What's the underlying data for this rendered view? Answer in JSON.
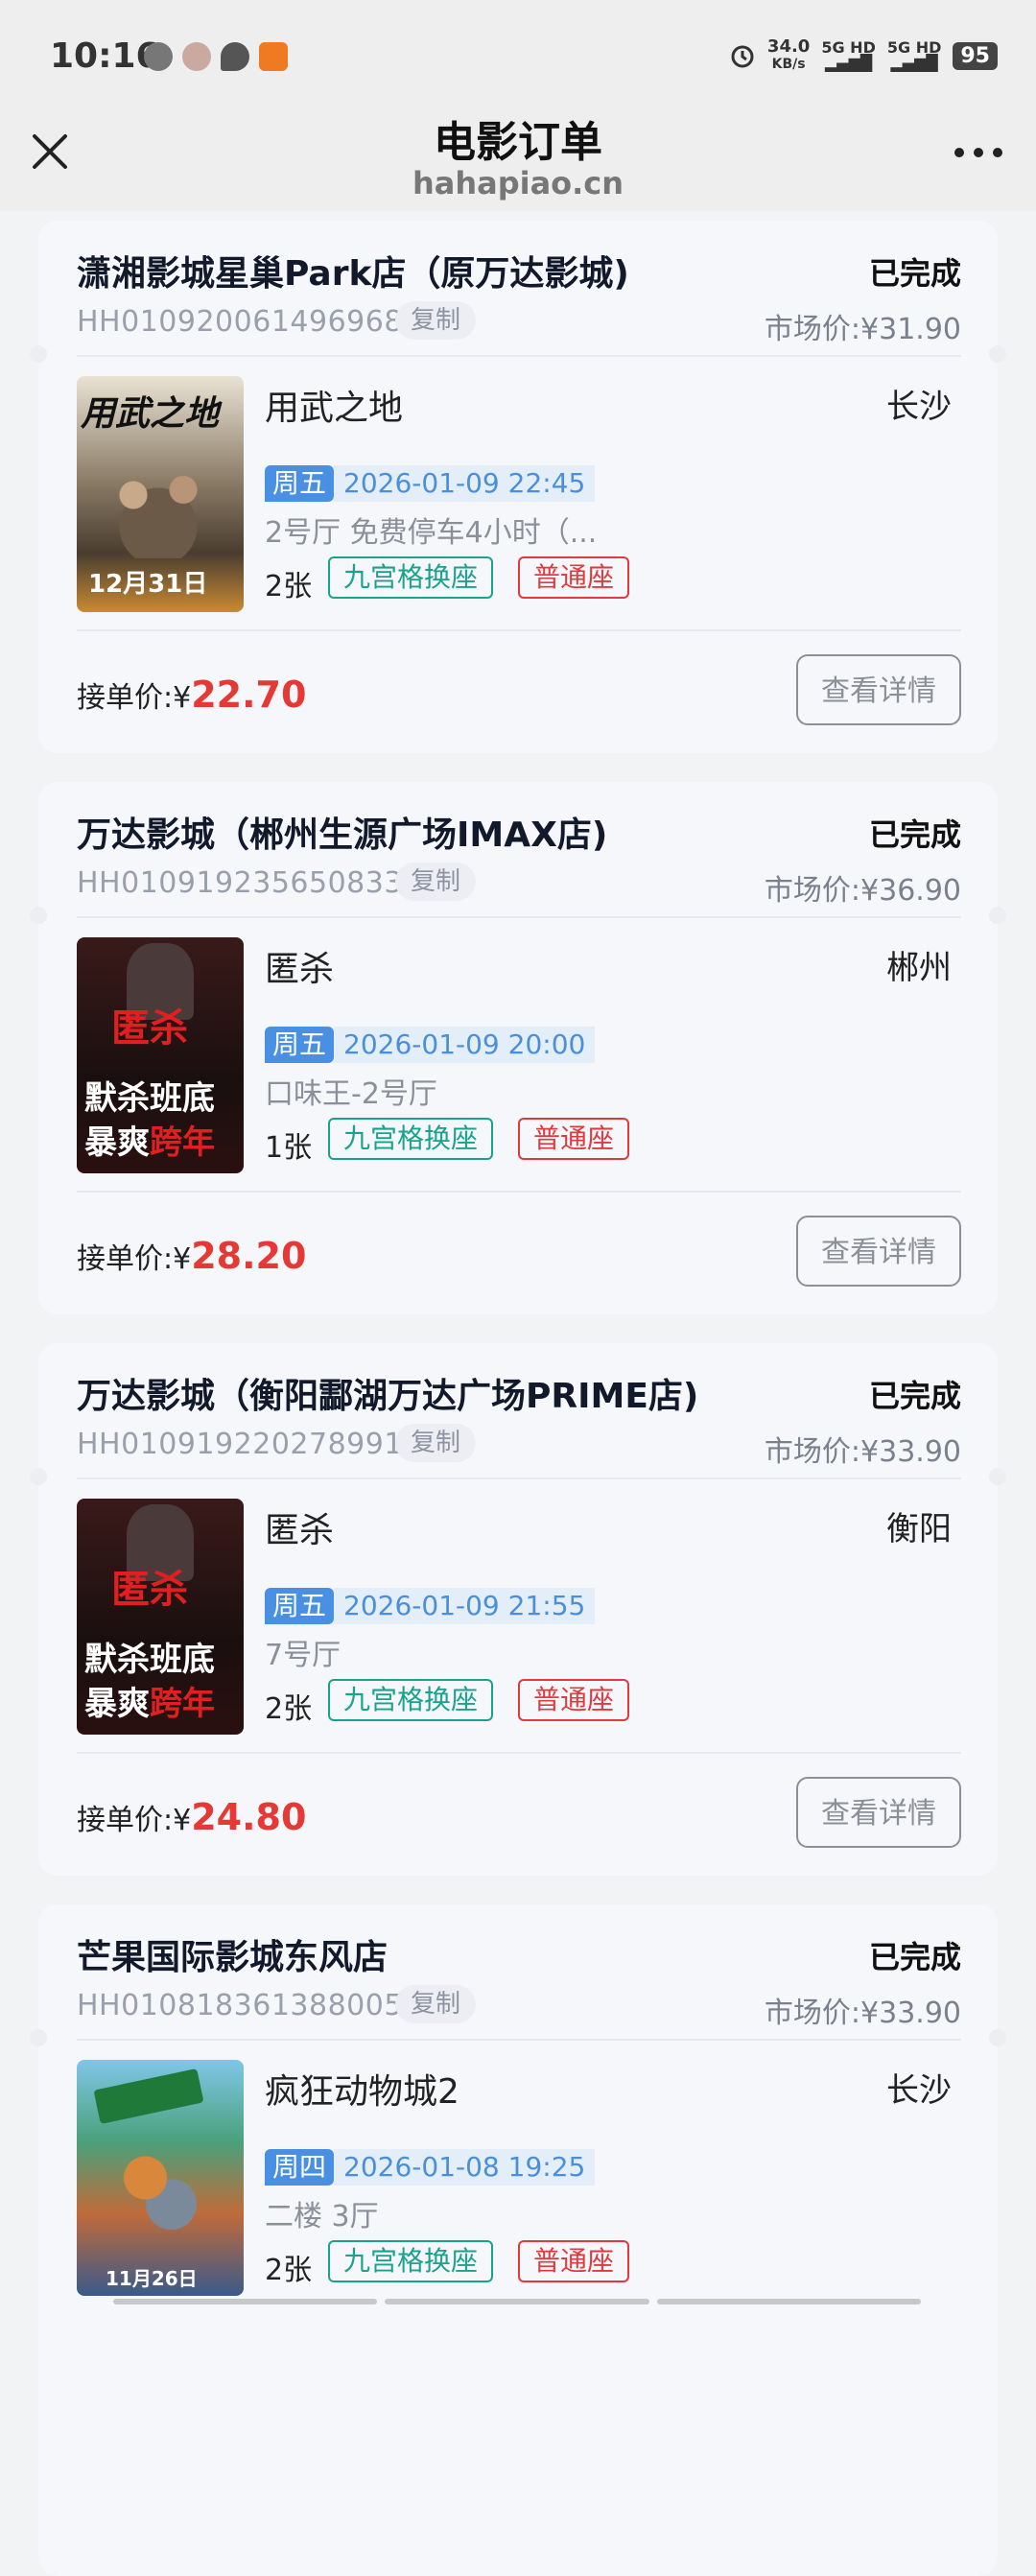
{
  "status_bar": {
    "time": "10:16",
    "net_speed_value": "34.0",
    "net_speed_unit": "KB/s",
    "signal1": "5G HD",
    "signal2": "5G HD",
    "battery": "95"
  },
  "header": {
    "title": "电影订单",
    "subtitle": "hahapiao.cn"
  },
  "orders": [
    {
      "cinema": "潇湘影城星巢Park店（原万达影城)",
      "status": "已完成",
      "order_no": "HH010920061496968",
      "copy_label": "复制",
      "market_price": "市场价:¥31.90",
      "movie": "用武之地",
      "city": "长沙",
      "weekday": "周五",
      "datetime": "2026-01-09 22:45",
      "hall": "2号厅 免费停车4小时（...",
      "qty": "2张",
      "tag1": "九宫格换座",
      "tag2": "普通座",
      "price_label": "接单价:¥",
      "price": "22.70",
      "detail_label": "查看详情"
    },
    {
      "cinema": "万达影城（郴州生源广场IMAX店)",
      "status": "已完成",
      "order_no": "HH010919235650833",
      "copy_label": "复制",
      "market_price": "市场价:¥36.90",
      "movie": "匿杀",
      "city": "郴州",
      "weekday": "周五",
      "datetime": "2026-01-09 20:00",
      "hall": "口味王-2号厅",
      "qty": "1张",
      "tag1": "九宫格换座",
      "tag2": "普通座",
      "price_label": "接单价:¥",
      "price": "28.20",
      "detail_label": "查看详情"
    },
    {
      "cinema": "万达影城（衡阳酃湖万达广场PRIME店)",
      "status": "已完成",
      "order_no": "HH010919220278991",
      "copy_label": "复制",
      "market_price": "市场价:¥33.90",
      "movie": "匿杀",
      "city": "衡阳",
      "weekday": "周五",
      "datetime": "2026-01-09 21:55",
      "hall": "7号厅",
      "qty": "2张",
      "tag1": "九宫格换座",
      "tag2": "普通座",
      "price_label": "接单价:¥",
      "price": "24.80",
      "detail_label": "查看详情"
    },
    {
      "cinema": "芒果国际影城东风店",
      "status": "已完成",
      "order_no": "HH010818361388005",
      "copy_label": "复制",
      "market_price": "市场价:¥33.90",
      "movie": "疯狂动物城2",
      "city": "长沙",
      "weekday": "周四",
      "datetime": "2026-01-08 19:25",
      "hall": "二楼 3厅",
      "qty": "2张",
      "tag1": "九宫格换座",
      "tag2": "普通座"
    }
  ],
  "posters": {
    "p1_text": "用武之地",
    "p1_date": "12月31日",
    "p2_text1": "匿杀",
    "p2_text2": "默杀班底",
    "p2_text3": "暴爽跨年",
    "p4_text": "11月26日"
  }
}
